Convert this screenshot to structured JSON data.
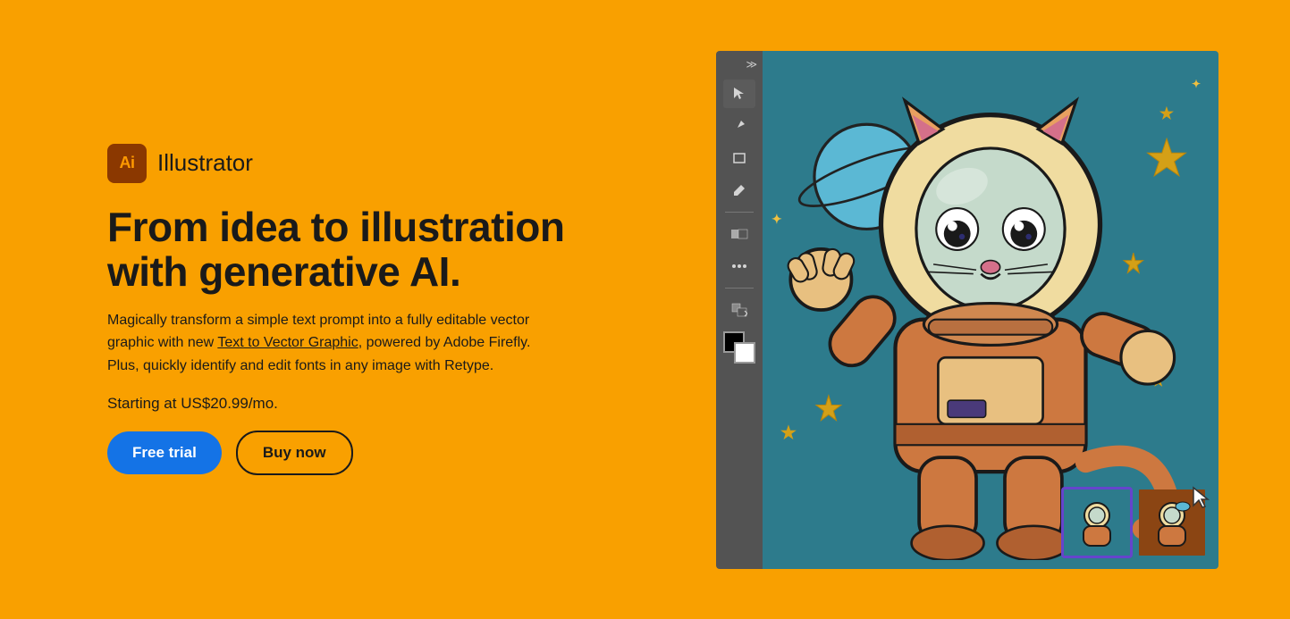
{
  "logo": {
    "icon_text": "Ai",
    "app_name": "Illustrator"
  },
  "hero": {
    "headline": "From idea to illustration with generative AI.",
    "description_part1": "Magically transform a simple text prompt into a fully editable vector graphic with new ",
    "link_text": "Text to Vector Graphic",
    "description_part2": ", powered by Adobe Firefly. Plus, quickly identify and edit fonts in any image with Retype.",
    "pricing": "Starting at US$20.99/mo.",
    "cta_free_trial": "Free trial",
    "cta_buy_now": "Buy now"
  },
  "toolbar": {
    "tools": [
      {
        "name": "expand",
        "icon": "≫"
      },
      {
        "name": "select",
        "icon": "▶"
      },
      {
        "name": "pen",
        "icon": "✒"
      },
      {
        "name": "rect",
        "icon": "□"
      },
      {
        "name": "eyedropper",
        "icon": "✏"
      },
      {
        "name": "shape",
        "icon": "◧"
      },
      {
        "name": "dots",
        "icon": "···"
      },
      {
        "name": "layers",
        "icon": "⊞"
      },
      {
        "name": "arrow",
        "icon": "↩"
      }
    ]
  },
  "colors": {
    "brand_orange": "#F9A000",
    "toolbar_bg": "#535353",
    "canvas_bg": "#2D7B8C",
    "ai_logo_bg": "#8B3800",
    "cta_blue": "#1473E6",
    "star_gold": "#D4A017",
    "thumb1_border": "#6644CC"
  }
}
